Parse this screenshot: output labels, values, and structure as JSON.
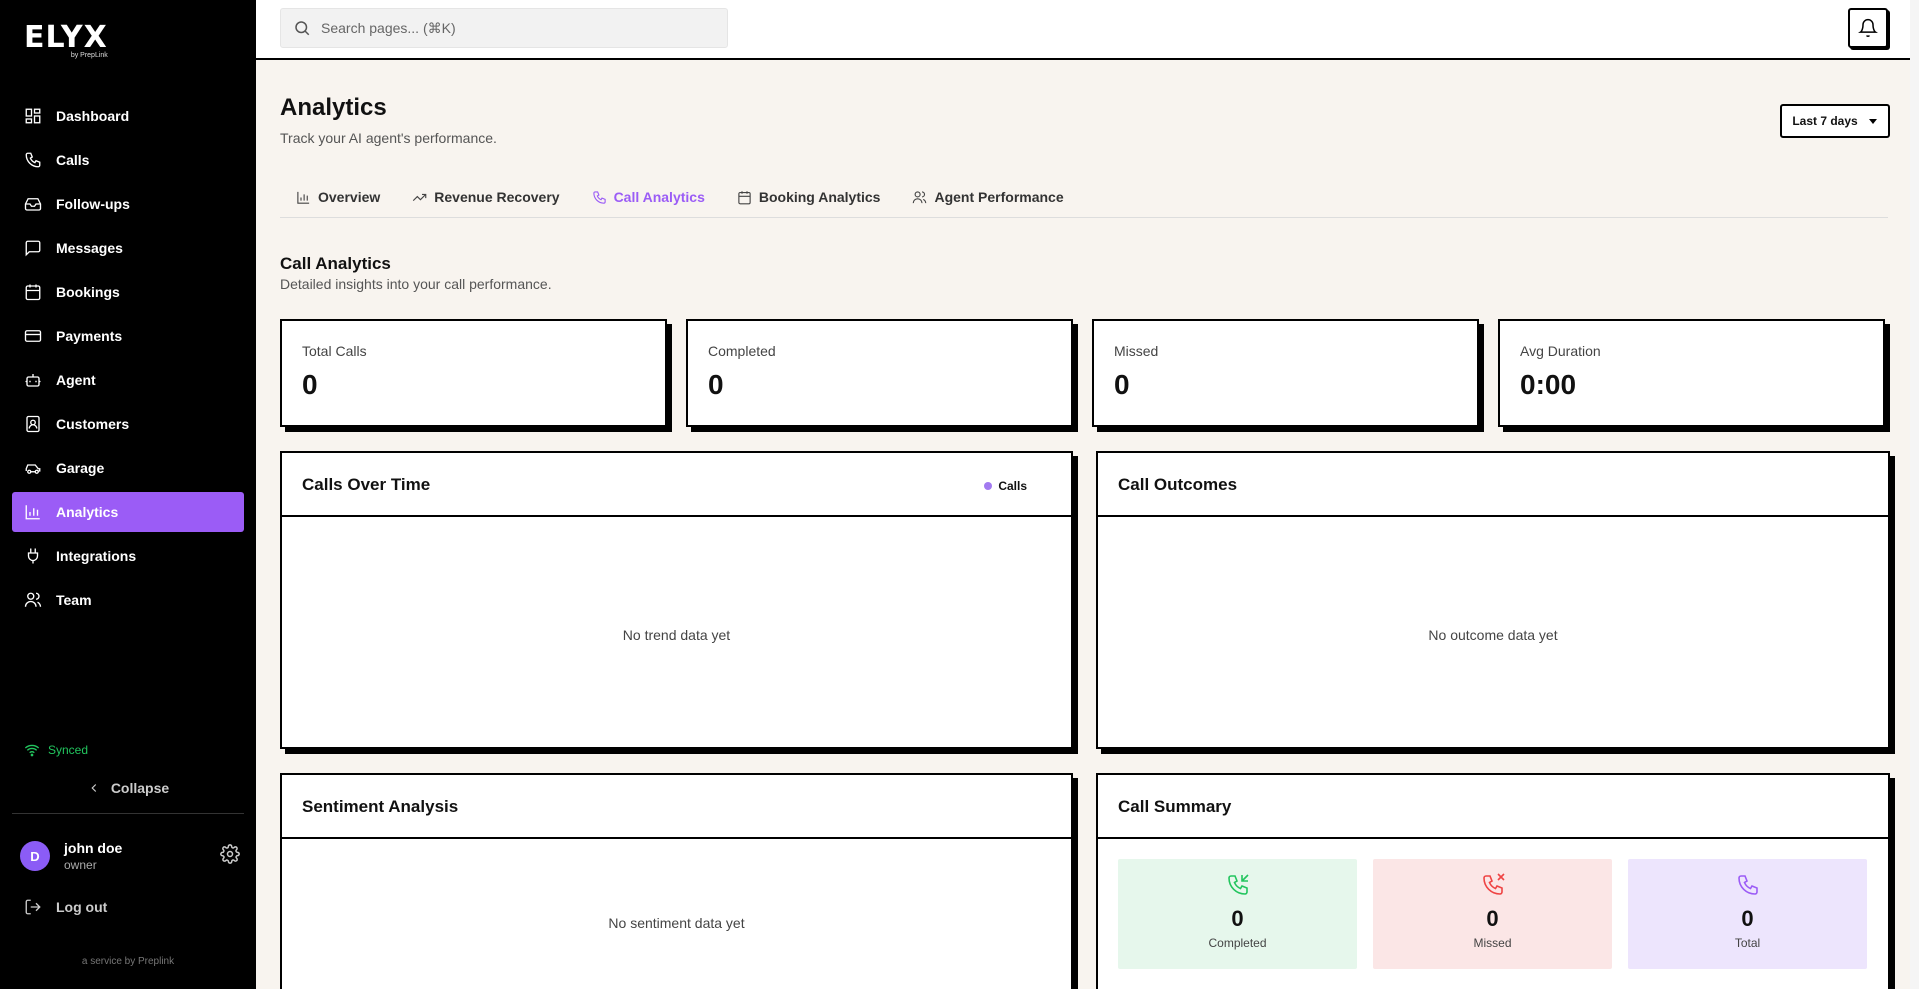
{
  "brand": {
    "name": "ELYX",
    "sub": "by PrepLink"
  },
  "sidebar": {
    "items": [
      {
        "label": "Dashboard",
        "icon": "dashboard-icon"
      },
      {
        "label": "Calls",
        "icon": "phone-icon"
      },
      {
        "label": "Follow-ups",
        "icon": "inbox-icon"
      },
      {
        "label": "Messages",
        "icon": "message-icon"
      },
      {
        "label": "Bookings",
        "icon": "calendar-icon"
      },
      {
        "label": "Payments",
        "icon": "credit-card-icon"
      },
      {
        "label": "Agent",
        "icon": "bot-icon"
      },
      {
        "label": "Customers",
        "icon": "contacts-icon"
      },
      {
        "label": "Garage",
        "icon": "car-icon"
      },
      {
        "label": "Analytics",
        "icon": "bar-chart-icon"
      },
      {
        "label": "Integrations",
        "icon": "plug-icon"
      },
      {
        "label": "Team",
        "icon": "users-icon"
      }
    ],
    "active": "Analytics",
    "synced": "Synced",
    "collapse": "Collapse",
    "user": {
      "initial": "D",
      "name": "john doe",
      "role": "owner"
    },
    "logout": "Log out",
    "service": "a service by Preplink"
  },
  "topbar": {
    "search_placeholder": "Search pages... (⌘K)"
  },
  "page": {
    "title": "Analytics",
    "subtitle": "Track your AI agent's performance.",
    "range": "Last 7 days",
    "tabs": [
      "Overview",
      "Revenue Recovery",
      "Call Analytics",
      "Booking Analytics",
      "Agent Performance"
    ],
    "active_tab": "Call Analytics",
    "section_title": "Call Analytics",
    "section_subtitle": "Detailed insights into your call performance."
  },
  "stats": [
    {
      "label": "Total Calls",
      "value": "0"
    },
    {
      "label": "Completed",
      "value": "0"
    },
    {
      "label": "Missed",
      "value": "0"
    },
    {
      "label": "Avg Duration",
      "value": "0:00"
    }
  ],
  "panels": {
    "calls_over_time": {
      "title": "Calls Over Time",
      "legend": "Calls",
      "empty": "No trend data yet"
    },
    "call_outcomes": {
      "title": "Call Outcomes",
      "empty": "No outcome data yet"
    },
    "sentiment": {
      "title": "Sentiment Analysis",
      "empty": "No sentiment data yet"
    },
    "summary": {
      "title": "Call Summary",
      "items": [
        {
          "value": "0",
          "label": "Completed"
        },
        {
          "value": "0",
          "label": "Missed"
        },
        {
          "value": "0",
          "label": "Total"
        }
      ]
    }
  },
  "colors": {
    "accent": "#9b5cf6",
    "completed_bg": "#e6f7ec",
    "missed_bg": "#fbe6e6",
    "total_bg": "#ede5fd",
    "synced": "#22c55e"
  }
}
